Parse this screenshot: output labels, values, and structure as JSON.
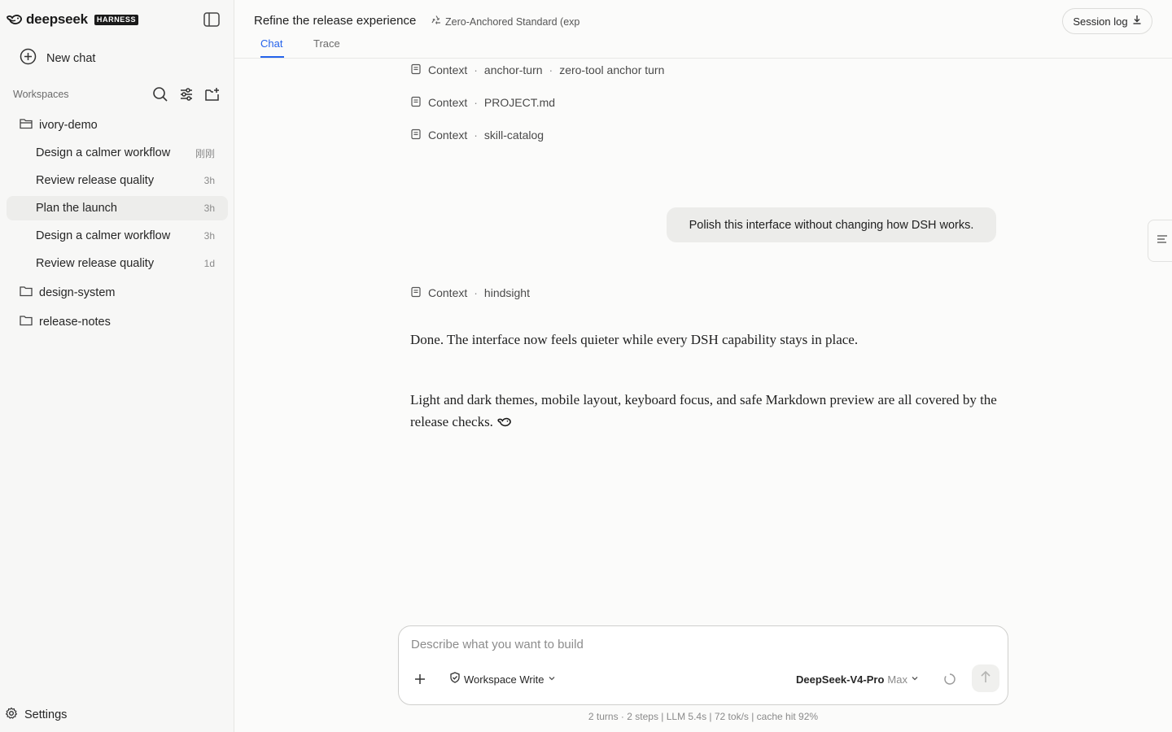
{
  "brand": {
    "wordmark": "deepseek",
    "badge": "HARNESS"
  },
  "sidebar": {
    "new_chat": "New chat",
    "workspaces_title": "Workspaces",
    "workspaces": [
      {
        "name": "ivory-demo",
        "open": true,
        "chats": [
          {
            "title": "Design a calmer workflow",
            "time": "刚刚"
          },
          {
            "title": "Review release quality",
            "time": "3h"
          },
          {
            "title": "Plan the launch",
            "time": "3h",
            "active": true
          },
          {
            "title": "Design a calmer workflow",
            "time": "3h"
          },
          {
            "title": "Review release quality",
            "time": "1d"
          }
        ]
      },
      {
        "name": "design-system",
        "open": false
      },
      {
        "name": "release-notes",
        "open": false
      }
    ],
    "settings": "Settings"
  },
  "header": {
    "title": "Refine the release experience",
    "standard": "Zero-Anchored Standard (exp",
    "session_log": "Session log",
    "tabs": [
      {
        "label": "Chat",
        "active": true
      },
      {
        "label": "Trace",
        "active": false
      }
    ]
  },
  "conversation": {
    "context_top": [
      {
        "label": "Context",
        "parts": [
          "anchor-turn",
          "zero-tool anchor turn"
        ]
      },
      {
        "label": "Context",
        "parts": [
          "PROJECT.md"
        ]
      },
      {
        "label": "Context",
        "parts": [
          "skill-catalog"
        ]
      }
    ],
    "user_message": "Polish this interface without changing how DSH works.",
    "context_after": {
      "label": "Context",
      "parts": [
        "hindsight"
      ]
    },
    "answer_p1": "Done. The interface now feels quieter while every DSH capability stays in place.",
    "answer_p2": "Light and dark themes, mobile layout, keyboard focus, and safe Markdown preview are all covered by the release checks."
  },
  "composer": {
    "placeholder": "Describe what you want to build",
    "mode": "Workspace Write",
    "model": "DeepSeek-V4-Pro",
    "effort": "Max"
  },
  "stats": "2 turns · 2 steps | LLM 5.4s | 72 tok/s | cache hit 92%",
  "colors": {
    "accent": "#2563eb",
    "sidebar_bg": "#f7f7f6",
    "active_row": "#ededeb",
    "bubble": "#ececea"
  }
}
